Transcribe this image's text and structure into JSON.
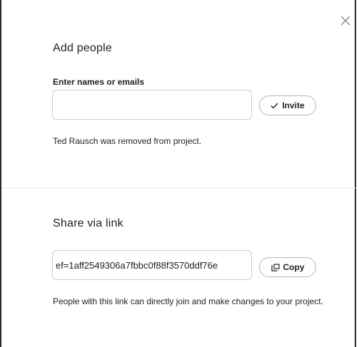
{
  "add_people": {
    "title": "Add people",
    "field_label": "Enter names or emails",
    "input_value": "",
    "input_placeholder": "",
    "invite_label": "Invite",
    "status_message": "Ted Rausch was removed from project."
  },
  "share_link": {
    "title": "Share via link",
    "link_value": "ef=1aff2549306a7fbbc0f88f3570ddf76e",
    "copy_label": "Copy",
    "note": "People with this link can directly join and make changes to your project."
  },
  "icons": {
    "close": "close-icon",
    "invite": "check-icon",
    "copy": "copy-icon"
  },
  "colors": {
    "text": "#1e1f21",
    "border": "#cfcbcb",
    "divider": "#e6e4e4"
  }
}
